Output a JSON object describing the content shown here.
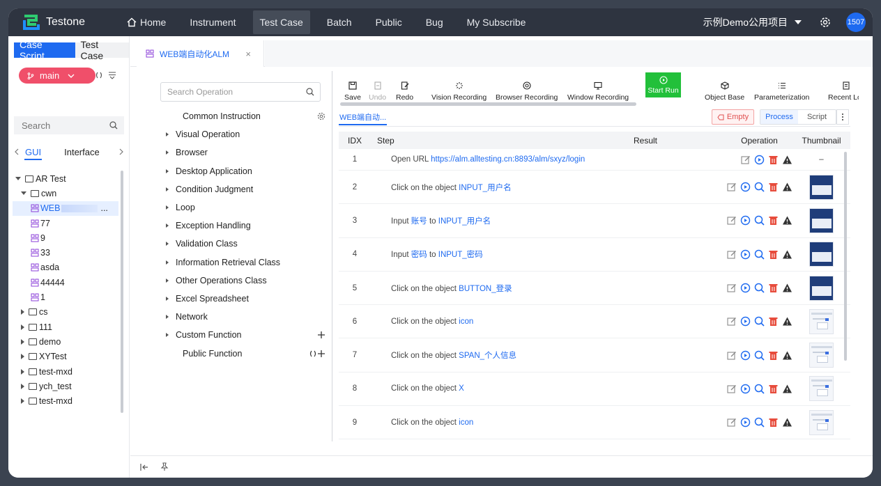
{
  "app": {
    "name": "Testone"
  },
  "nav": {
    "items": [
      {
        "id": "home",
        "label": "Home"
      },
      {
        "id": "instrument",
        "label": "Instrument"
      },
      {
        "id": "testcase",
        "label": "Test Case"
      },
      {
        "id": "batch",
        "label": "Batch"
      },
      {
        "id": "public",
        "label": "Public"
      },
      {
        "id": "bug",
        "label": "Bug"
      },
      {
        "id": "subscribe",
        "label": "My Subscribe"
      }
    ],
    "active": "Test Case",
    "project": "示例Demo公用项目",
    "user_badge": "1507"
  },
  "sidebar": {
    "tab_active": "Case Script",
    "tab_inactive": "Test Case",
    "branch": "main",
    "search_placeholder": "Search",
    "subtab_active": "GUI",
    "subtab_inactive": "Interface",
    "tree": [
      {
        "label": "AR Test",
        "type": "folder",
        "level": 0,
        "expanded": true
      },
      {
        "label": "cwn",
        "type": "folder",
        "level": 1,
        "expanded": true
      },
      {
        "label": "WEB",
        "type": "case",
        "level": 2,
        "selected": true,
        "suffix": "..."
      },
      {
        "label": "77",
        "type": "case",
        "level": 2
      },
      {
        "label": "9",
        "type": "case",
        "level": 2
      },
      {
        "label": "33",
        "type": "case",
        "level": 2
      },
      {
        "label": "asda",
        "type": "case",
        "level": 2
      },
      {
        "label": "44444",
        "type": "case",
        "level": 2
      },
      {
        "label": "1",
        "type": "case",
        "level": 2
      },
      {
        "label": "cs",
        "type": "folder",
        "level": 1
      },
      {
        "label": "111",
        "type": "folder",
        "level": 1
      },
      {
        "label": "demo",
        "type": "folder",
        "level": 1
      },
      {
        "label": "XYTest",
        "type": "folder",
        "level": 1
      },
      {
        "label": "test-mxd",
        "type": "folder",
        "level": 1
      },
      {
        "label": "ych_test",
        "type": "folder",
        "level": 1
      },
      {
        "label": "test-mxd",
        "type": "folder",
        "level": 1
      }
    ]
  },
  "doc_tab": {
    "title": "WEB端自动化ALM",
    "close": "×"
  },
  "operations": {
    "search_placeholder": "Search Operation",
    "items": [
      {
        "label": "Common Instruction",
        "expandable": false,
        "action": "gear"
      },
      {
        "label": "Visual Operation",
        "expandable": true
      },
      {
        "label": "Browser",
        "expandable": true
      },
      {
        "label": "Desktop Application",
        "expandable": true
      },
      {
        "label": "Condition Judgment",
        "expandable": true
      },
      {
        "label": "Loop",
        "expandable": true
      },
      {
        "label": "Exception Handling",
        "expandable": true
      },
      {
        "label": "Validation Class",
        "expandable": true
      },
      {
        "label": "Information Retrieval Class",
        "expandable": true
      },
      {
        "label": "Other Operations Class",
        "expandable": true
      },
      {
        "label": "Excel Spreadsheet",
        "expandable": true
      },
      {
        "label": "Network",
        "expandable": true
      },
      {
        "label": "Custom Function",
        "expandable": true,
        "action": "plus"
      },
      {
        "label": "Public Function",
        "expandable": false,
        "action": "refresh-plus"
      }
    ]
  },
  "toolbar": {
    "save": "Save",
    "undo": "Undo",
    "redo": "Redo",
    "vision": "Vision Recording",
    "browser": "Browser Recording",
    "window": "Window Recording",
    "start": "Start Run",
    "object": "Object Base",
    "param": "Parameterization",
    "recent": "Recent Log"
  },
  "case_tab": "WEB端自动...",
  "controls": {
    "empty": "Empty",
    "process": "Process",
    "script": "Script"
  },
  "table": {
    "headers": {
      "idx": "IDX",
      "step": "Step",
      "result": "Result",
      "operation": "Operation",
      "thumbnail": "Thumbnail"
    },
    "rows": [
      {
        "idx": "1",
        "pre": "Open URL ",
        "obj": "https://alm.alltesting.cn:8893/alm/sxyz/login",
        "thumb": "–"
      },
      {
        "idx": "2",
        "pre": "Click on the object ",
        "obj": "INPUT_用户名",
        "thumb": "dark"
      },
      {
        "idx": "3",
        "pre": "Input ",
        "val": "账号",
        "mid": " to ",
        "obj": "INPUT_用户名",
        "thumb": "dark"
      },
      {
        "idx": "4",
        "pre": "Input ",
        "val": "密码",
        "mid": " to ",
        "obj": "INPUT_密码",
        "thumb": "dark"
      },
      {
        "idx": "5",
        "pre": "Click on the object ",
        "obj": "BUTTON_登录",
        "thumb": "dark"
      },
      {
        "idx": "6",
        "pre": "Click on the object ",
        "obj": "icon",
        "thumb": "light"
      },
      {
        "idx": "7",
        "pre": "Click on the object ",
        "obj": "SPAN_个人信息",
        "thumb": "light"
      },
      {
        "idx": "8",
        "pre": "Click on the object ",
        "obj": "X",
        "thumb": "light"
      },
      {
        "idx": "9",
        "pre": "Click on the object ",
        "obj": "icon",
        "thumb": "light"
      }
    ]
  },
  "colors": {
    "accent": "#1e6af0",
    "nav_bg": "#2e3440",
    "branch": "#f04f6a",
    "run": "#22c03a",
    "danger": "#e05050"
  }
}
